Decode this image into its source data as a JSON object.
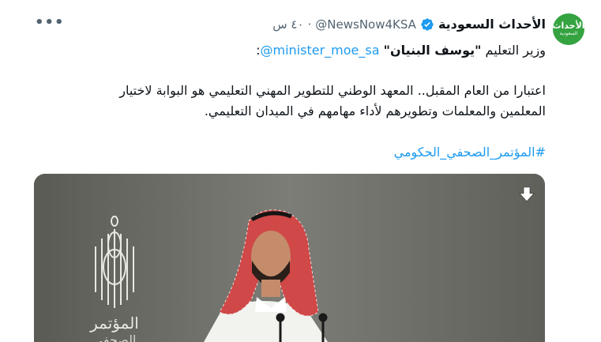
{
  "account": {
    "display_name": "الأحداث السعودية",
    "handle": "@NewsNow4KSA",
    "dot": "·",
    "time": "٤٠ س",
    "avatar_text_main": "الأحداث",
    "avatar_text_sub": "السعودية"
  },
  "quote_line": {
    "prefix": "وزير التعليم ",
    "name": "\"يوسف البنيان\"",
    "mention": "@minister_moe_sa",
    "suffix": ":"
  },
  "body": {
    "line1": "اعتبارا من العام المقبل.. المعهد الوطني للتطوير المهني التعليمي هو البوابة لاختيار",
    "line2": "المعلمين والمعلمات وتطويرهم لأداء مهامهم في الميدان التعليمي."
  },
  "hashtag": "#المؤتمر_الصحفي_الحكومي",
  "media": {
    "logo_text": "المؤتمر",
    "logo_text_2": "الصحفي"
  },
  "icons": {
    "verified": "verified-badge-icon",
    "more": "more-options-icon",
    "download": "download-icon"
  },
  "colors": {
    "link": "#1d9bf0",
    "secondary": "#536471",
    "avatar_bg": "#34a340"
  }
}
